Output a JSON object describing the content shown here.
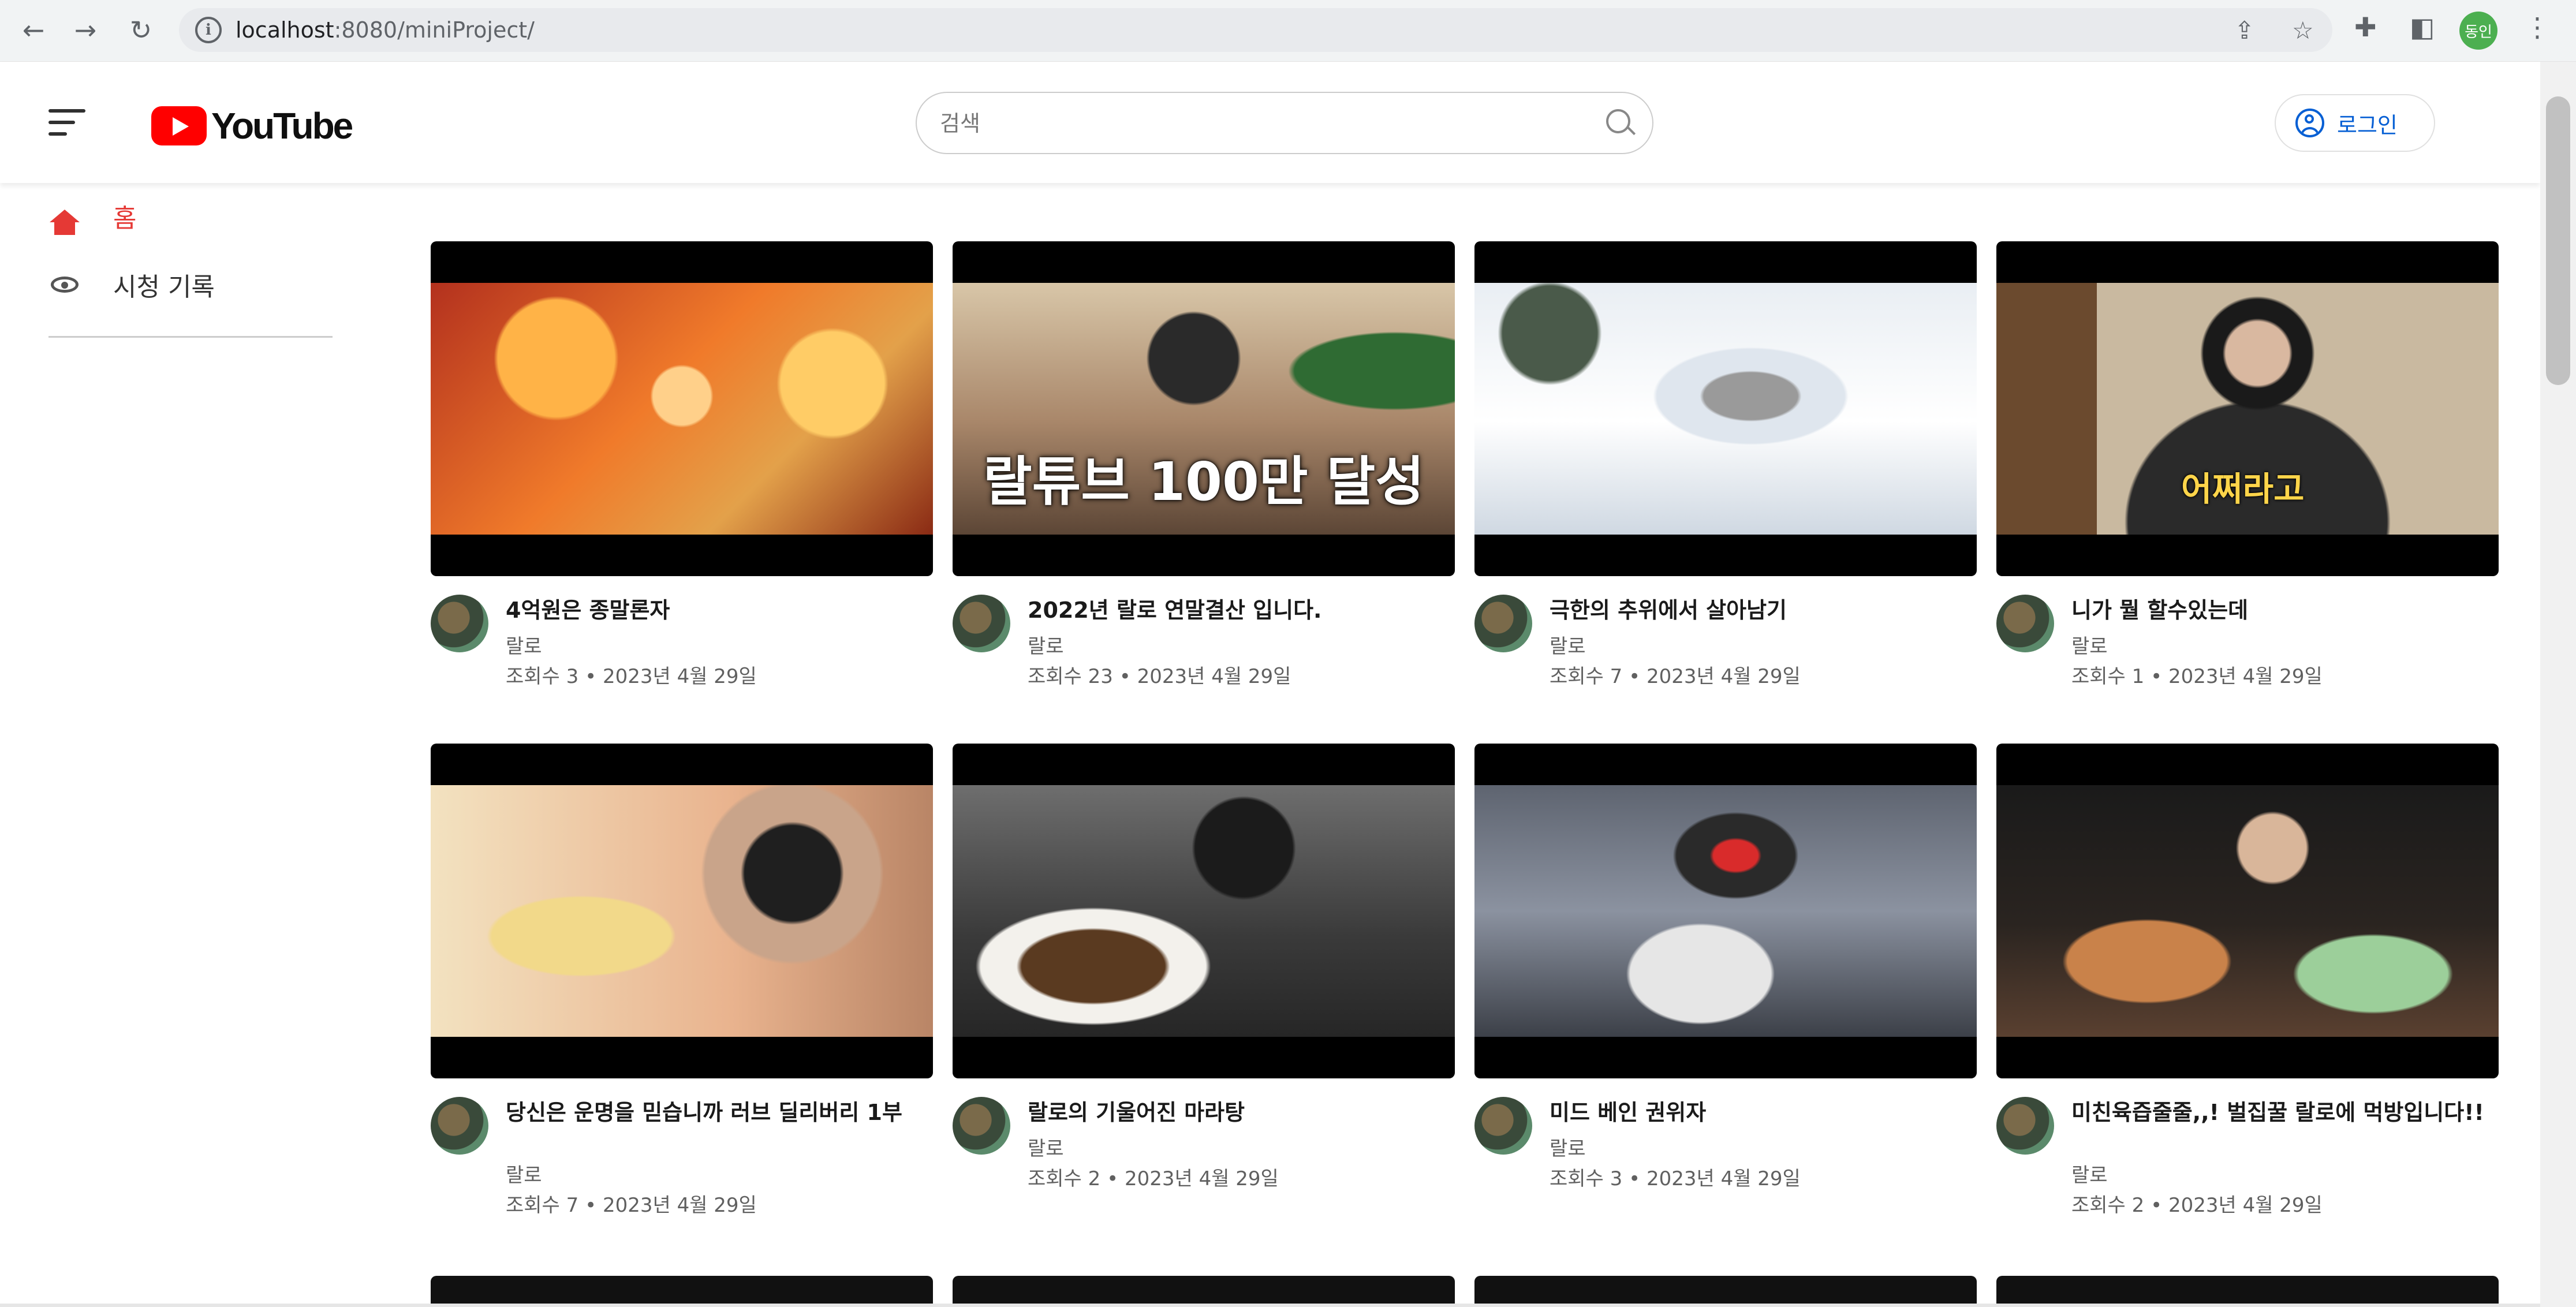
{
  "browser": {
    "url_host": "localhost",
    "url_rest": ":8080/miniProject/",
    "profile_label": "동인"
  },
  "header": {
    "logo_text": "YouTube",
    "search_placeholder": "검색",
    "login_label": "로그인"
  },
  "sidebar": {
    "items": [
      {
        "label": "홈",
        "active": true
      },
      {
        "label": "시청 기록",
        "active": false
      }
    ]
  },
  "videos": [
    {
      "title": "4억원은 종말론자",
      "channel": "랄로",
      "stats": "조회수 3 • 2023년 4월 29일"
    },
    {
      "title": "2022년 랄로 연말결산 입니다.",
      "channel": "랄로",
      "stats": "조회수 23 • 2023년 4월 29일",
      "thumb_caption": "랄튜브 100만 달성"
    },
    {
      "title": "극한의 추위에서 살아남기",
      "channel": "랄로",
      "stats": "조회수 7 • 2023년 4월 29일"
    },
    {
      "title": "니가 뭘 할수있는데",
      "channel": "랄로",
      "stats": "조회수 1 • 2023년 4월 29일",
      "thumb_caption": "어쩌라고"
    },
    {
      "title": "당신은 운명을 믿습니까 러브 딜리버리 1부",
      "channel": "랄로",
      "stats": "조회수 7 • 2023년 4월 29일"
    },
    {
      "title": "랄로의 기울어진 마라탕",
      "channel": "랄로",
      "stats": "조회수 2 • 2023년 4월 29일"
    },
    {
      "title": "미드 베인 권위자",
      "channel": "랄로",
      "stats": "조회수 3 • 2023년 4월 29일"
    },
    {
      "title": "미친육즙줄줄,,! 벌집꿀 랄로에 먹방입니다!!",
      "channel": "랄로",
      "stats": "조회수 2 • 2023년 4월 29일"
    }
  ],
  "colors": {
    "accent": "#e53935",
    "youtube_red": "#ff0000",
    "link_blue": "#065fd4"
  }
}
